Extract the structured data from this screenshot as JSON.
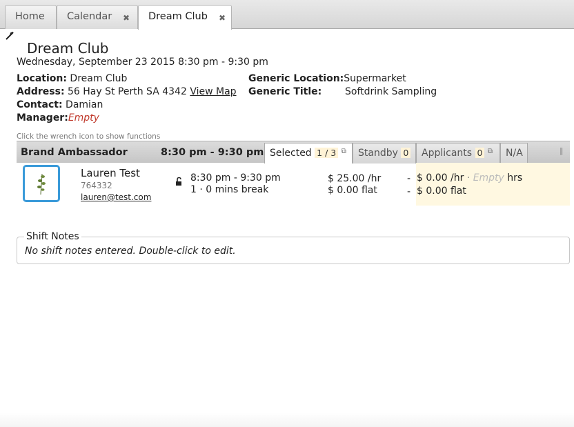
{
  "tabs": [
    {
      "label": "Home",
      "closable": false
    },
    {
      "label": "Calendar",
      "closable": true
    },
    {
      "label": "Dream Club",
      "closable": true,
      "active": true
    }
  ],
  "close_glyph": "✖",
  "wrench_icon": "wrench-icon",
  "event": {
    "title": "Dream Club",
    "datetime": "Wednesday, September 23 2015 8:30 pm - 9:30 pm"
  },
  "details": {
    "location_label": "Location:",
    "location_value": "Dream Club",
    "address_label": "Address:",
    "address_value": "56 Hay St Perth SA 4342",
    "view_map": "View Map",
    "contact_label": "Contact:",
    "contact_value": "Damian",
    "manager_label": "Manager:",
    "manager_value": "Empty",
    "generic_location_label": "Generic Location:",
    "generic_location_value": "Supermarket",
    "generic_title_label": "Generic Title:",
    "generic_title_value": "Softdrink Sampling"
  },
  "hint": "Click the wrench icon to show functions",
  "role_bar": {
    "role": "Brand Ambassador",
    "time": "8:30 pm - 9:30 pm",
    "tabs": {
      "selected": {
        "label": "Selected",
        "count": "1 / 3"
      },
      "standby": {
        "label": "Standby",
        "count": "0"
      },
      "applicants": {
        "label": "Applicants",
        "count": "0"
      },
      "na": {
        "label": "N/A"
      }
    }
  },
  "staff": {
    "name": "Lauren Test",
    "id": "764332",
    "email": "lauren@test.com",
    "shift_time": "8:30 pm - 9:30 pm",
    "break": "1 · 0 mins break",
    "rate_hr": "$ 25.00 /hr",
    "rate_flat": "$ 0.00 flat",
    "dash1": "-",
    "dash2": "-",
    "pay_hr": "$ 0.00 /hr",
    "pay_sep": "·",
    "pay_hrs_placeholder": "Empty",
    "pay_hrs_unit": "hrs",
    "pay_flat": "$ 0.00 flat"
  },
  "notes": {
    "legend": "Shift Notes",
    "text": "No shift notes entered. Double-click to edit."
  },
  "colors": {
    "accent": "#3a9ad9",
    "empty": "#c0392b",
    "highlight": "#fff8e1"
  }
}
